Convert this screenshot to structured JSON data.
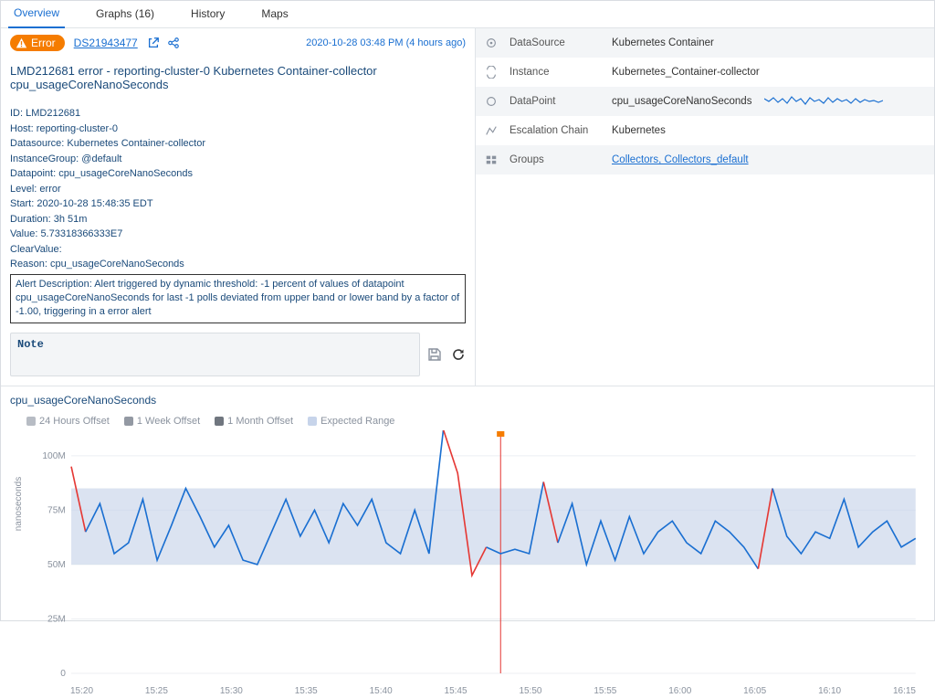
{
  "tabs": [
    {
      "label": "Overview",
      "active": true
    },
    {
      "label": "Graphs (16)",
      "active": false
    },
    {
      "label": "History",
      "active": false
    },
    {
      "label": "Maps",
      "active": false
    }
  ],
  "header": {
    "badge_label": "Error",
    "ds_link": "DS21943477",
    "timestamp": "2020-10-28 03:48 PM (4 hours ago)"
  },
  "alert_title": "LMD212681 error - reporting-cluster-0 Kubernetes Container-collector cpu_usageCoreNanoSeconds",
  "details": {
    "id": "LMD212681",
    "host": "reporting-cluster-0",
    "datasource": "Kubernetes Container-collector",
    "instance_group": "@default",
    "datapoint": "cpu_usageCoreNanoSeconds",
    "level": "error",
    "start": "2020-10-28 15:48:35 EDT",
    "duration": "3h 51m",
    "value": "5.73318366333E7",
    "clear_value": "",
    "reason": "cpu_usageCoreNanoSeconds"
  },
  "labels": {
    "id": "ID: ",
    "host": "Host: ",
    "datasource": "Datasource: ",
    "instance_group": "InstanceGroup: ",
    "datapoint": "Datapoint: ",
    "level": "Level: ",
    "start": "Start: ",
    "duration": "Duration: ",
    "value": "Value: ",
    "clear_value": "ClearValue:",
    "reason": "Reason: ",
    "alert_desc_prefix": "Alert Description: "
  },
  "alert_description": "Alert triggered by dynamic threshold: -1 percent of values of datapoint cpu_usageCoreNanoSeconds for last -1 polls deviated from upper band or lower band by a factor of -1.00, triggering in a error alert",
  "note_placeholder": "Note",
  "info_table": {
    "datasource_label": "DataSource",
    "datasource_value": "Kubernetes Container",
    "instance_label": "Instance",
    "instance_value": "Kubernetes_Container-collector",
    "datapoint_label": "DataPoint",
    "datapoint_value": "cpu_usageCoreNanoSeconds",
    "escalation_label": "Escalation Chain",
    "escalation_value": "Kubernetes",
    "groups_label": "Groups",
    "groups_value": "Collectors, Collectors_default"
  },
  "chart": {
    "title": "cpu_usageCoreNanoSeconds",
    "y_axis_label": "nanoseconds",
    "legend": {
      "offset24h": "24 Hours Offset",
      "offset1w": "1 Week Offset",
      "offset1m": "1 Month Offset",
      "expected": "Expected Range"
    },
    "y_ticks": [
      "0",
      "25M",
      "50M",
      "75M",
      "100M"
    ],
    "x_ticks": [
      "15:20",
      "15:25",
      "15:30",
      "15:35",
      "15:40",
      "15:45",
      "15:50",
      "15:55",
      "16:00",
      "16:05",
      "16:10",
      "16:15"
    ]
  },
  "chart_data": {
    "type": "line",
    "title": "cpu_usageCoreNanoSeconds",
    "xlabel": "",
    "ylabel": "nanoseconds",
    "ylim": [
      0,
      110000000
    ],
    "x_range": [
      "15:18",
      "15:19",
      "15:20",
      "15:21",
      "15:22",
      "15:23",
      "15:24",
      "15:25",
      "15:26",
      "15:27",
      "15:28",
      "15:29",
      "15:30",
      "15:31",
      "15:32",
      "15:33",
      "15:34",
      "15:35",
      "15:36",
      "15:37",
      "15:38",
      "15:39",
      "15:40",
      "15:41",
      "15:42",
      "15:43",
      "15:44",
      "15:45",
      "15:46",
      "15:47",
      "15:48",
      "15:49",
      "15:50",
      "15:51",
      "15:52",
      "15:53",
      "15:54",
      "15:55",
      "15:56",
      "15:57",
      "15:58",
      "15:59",
      "16:00",
      "16:01",
      "16:02",
      "16:03",
      "16:04",
      "16:05",
      "16:06",
      "16:07",
      "16:08",
      "16:09",
      "16:10",
      "16:11",
      "16:12",
      "16:13",
      "16:14",
      "16:15",
      "16:16",
      "16:17"
    ],
    "expected_band": {
      "lower": 50000000,
      "upper": 85000000
    },
    "alert_marker_x": "15:48",
    "series": [
      {
        "name": "value",
        "color": "#1a6fd1",
        "values": [
          95000000,
          65000000,
          78000000,
          55000000,
          60000000,
          80000000,
          52000000,
          68000000,
          85000000,
          72000000,
          58000000,
          68000000,
          52000000,
          50000000,
          65000000,
          80000000,
          63000000,
          75000000,
          60000000,
          78000000,
          68000000,
          80000000,
          60000000,
          55000000,
          75000000,
          55000000,
          112000000,
          92000000,
          45000000,
          58000000,
          55000000,
          57000000,
          55000000,
          88000000,
          60000000,
          78000000,
          50000000,
          70000000,
          52000000,
          72000000,
          55000000,
          65000000,
          70000000,
          60000000,
          55000000,
          70000000,
          65000000,
          58000000,
          48000000,
          85000000,
          63000000,
          55000000,
          65000000,
          62000000,
          80000000,
          58000000,
          65000000,
          70000000,
          58000000,
          62000000
        ]
      }
    ]
  }
}
